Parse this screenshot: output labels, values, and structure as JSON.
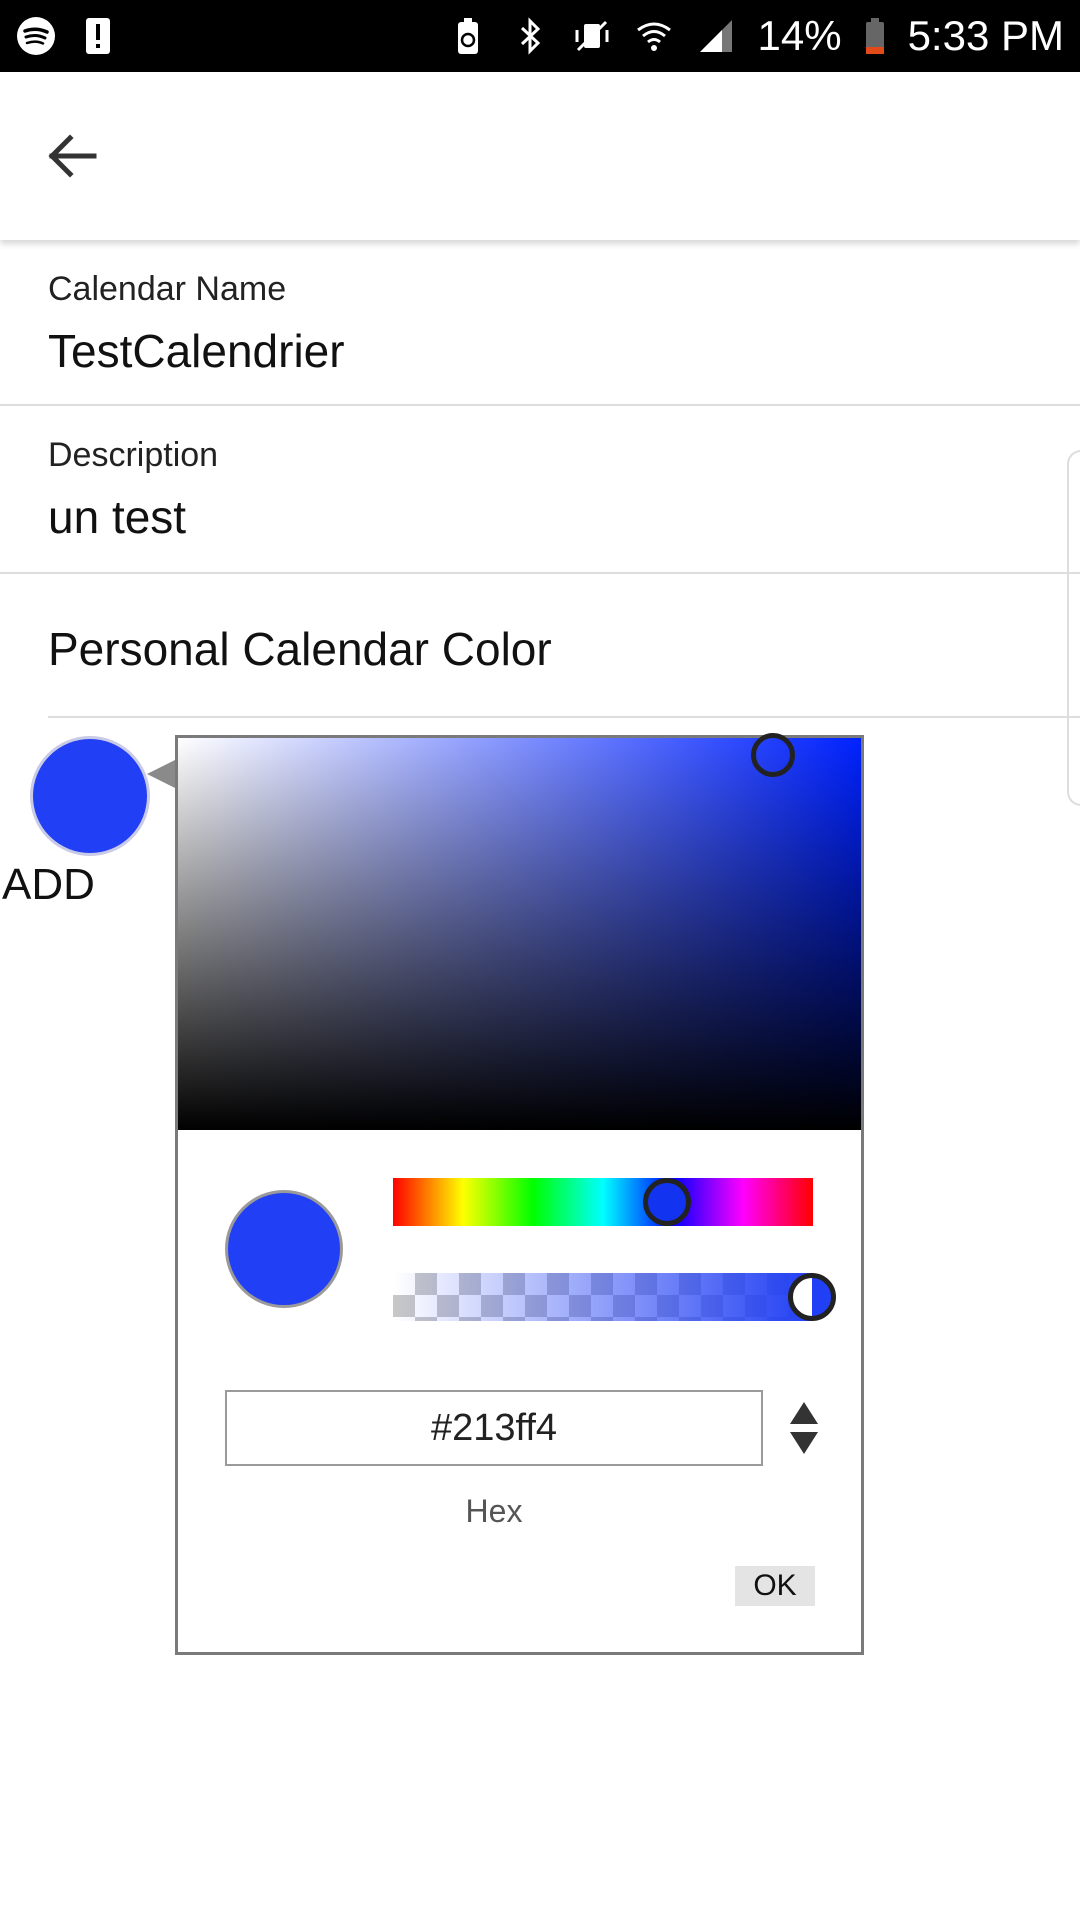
{
  "status_bar": {
    "icons_left": [
      "spotify-icon",
      "alert-icon"
    ],
    "icons_right": [
      "battery-saver-icon",
      "bluetooth-icon",
      "vibrate-icon",
      "wifi-icon",
      "signal-icon"
    ],
    "battery": "14%",
    "time": "5:33 PM"
  },
  "app_bar": {
    "back_icon": "back-arrow-icon"
  },
  "form": {
    "calendar_name_label": "Calendar Name",
    "calendar_name_value": "TestCalendrier",
    "description_label": "Description",
    "description_value": "un test",
    "color_section_title": "Personal Calendar Color"
  },
  "color": {
    "add_label": "ADD",
    "selected_color": "#213ff4"
  },
  "picker": {
    "hex_value": "#213ff4",
    "format_label": "Hex",
    "ok_label": "OK",
    "hue_level": 0.64,
    "alpha_level": 1.0
  }
}
